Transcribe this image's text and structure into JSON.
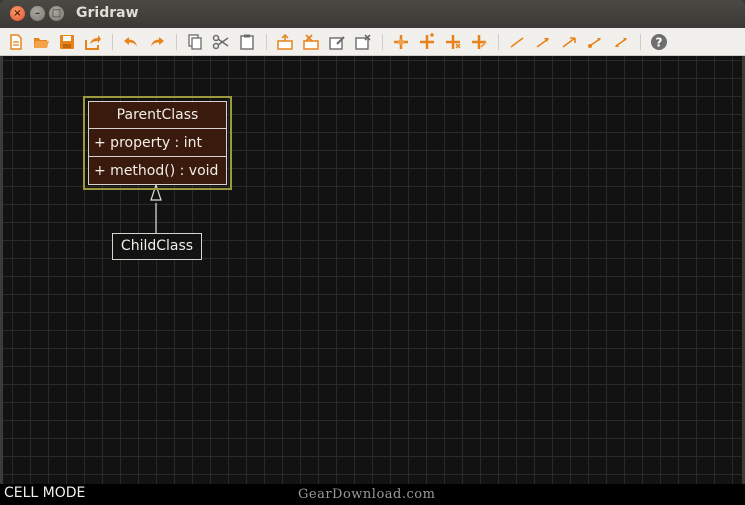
{
  "window": {
    "title": "Gridraw",
    "controls": {
      "close": "×",
      "minimize": "–",
      "maximize": "□"
    }
  },
  "toolbar": {
    "accent": "#e8831b",
    "neutral": "#6b6b6b",
    "help_color": "#6e6e6e",
    "buttons": [
      {
        "icon": "new-file-icon"
      },
      {
        "icon": "open-folder-icon"
      },
      {
        "icon": "save-icon"
      },
      {
        "icon": "export-icon"
      },
      {
        "icon": "undo-icon"
      },
      {
        "icon": "redo-icon"
      },
      {
        "icon": "copy-icon"
      },
      {
        "icon": "cut-icon"
      },
      {
        "icon": "paste-icon"
      },
      {
        "icon": "insert-shape-icon"
      },
      {
        "icon": "delete-shape-icon"
      },
      {
        "icon": "edit-shape-icon"
      },
      {
        "icon": "remove-shape-icon"
      },
      {
        "icon": "connect-icon"
      },
      {
        "icon": "connect-add-icon"
      },
      {
        "icon": "disconnect-icon"
      },
      {
        "icon": "connect-remove-icon"
      },
      {
        "icon": "line-icon"
      },
      {
        "icon": "arrow-line-icon"
      },
      {
        "icon": "open-arrow-line-icon"
      },
      {
        "icon": "dot-arrow-line-icon"
      },
      {
        "icon": "double-arrow-line-icon"
      },
      {
        "icon": "help-icon",
        "glyph": "?"
      }
    ]
  },
  "canvas": {
    "background": "#121212",
    "grid_color": "#2a2a2a",
    "selection_color": "#9c9a3a",
    "parent_class": {
      "name": "ParentClass",
      "property": "+ property : int",
      "method": "+ method() : void",
      "fill": "#3a1a0c"
    },
    "child_class": {
      "name": "ChildClass"
    }
  },
  "status": {
    "mode": "CELL MODE",
    "watermark": "GearDownload.com"
  }
}
